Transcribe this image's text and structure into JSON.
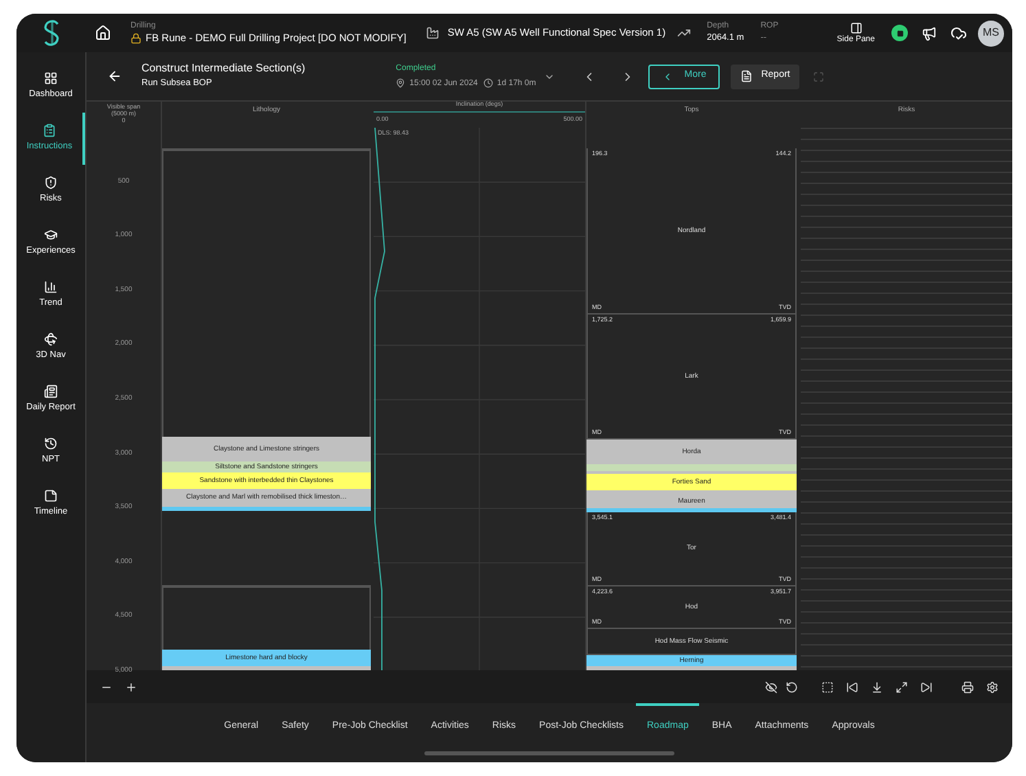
{
  "top_bar": {
    "module_label": "Drilling",
    "project": "FB Rune - DEMO Full Drilling Project [DO NOT MODIFY]",
    "well": "SW A5 (SW A5 Well Functional Spec Version 1)",
    "depth_label": "Depth",
    "depth_value": "2064.1 m",
    "rop_label": "ROP",
    "rop_value": "--",
    "side_pane": "Side Pane",
    "avatar": "MS"
  },
  "sidebar": {
    "items": [
      {
        "label": "Dashboard",
        "selected": false
      },
      {
        "label": "Instructions",
        "selected": true
      },
      {
        "label": "Risks",
        "selected": false
      },
      {
        "label": "Experiences",
        "selected": false
      },
      {
        "label": "Trend",
        "selected": false
      },
      {
        "label": "3D Nav",
        "selected": false
      },
      {
        "label": "Daily Report",
        "selected": false
      },
      {
        "label": "NPT",
        "selected": false
      },
      {
        "label": "Timeline",
        "selected": false
      }
    ]
  },
  "header": {
    "title": "Construct Intermediate Section(s)",
    "subtitle": "Run Subsea BOP",
    "status": "Completed",
    "date": "15:00 02 Jun 2024",
    "duration": "1d 17h 0m",
    "more_button": "More",
    "report_button": "Report"
  },
  "ruler": {
    "title": "Visible span (5000 m)",
    "zero": "0",
    "ticks": [
      "500",
      "1,000",
      "1,500",
      "2,000",
      "2,500",
      "3,000",
      "3,500",
      "4,000",
      "4,500",
      "5,000"
    ]
  },
  "lithology": {
    "title": "Lithology",
    "layers": [
      {
        "text": "Claystone and Limestone stringers",
        "color": "#c0c0c0"
      },
      {
        "text": "Siltstone and Sandstone stringers",
        "color": "#c6ddb4"
      },
      {
        "text": "Sandstone with interbedded thin Claystones",
        "color": "#ffff66"
      },
      {
        "text": "Claystone and Marl with remobilised thick limeston…",
        "color": "#c0c0c0"
      },
      {
        "color": "#5ec8f0"
      },
      {
        "text": "Limestone hard and blocky",
        "color": "#66ccf5"
      },
      {
        "color": "#c0c0c0"
      }
    ]
  },
  "inclination": {
    "title": "Inclination (degs)",
    "min": "0.00",
    "max": "500.00",
    "dls": "DLS: 98.43"
  },
  "tops": {
    "title": "Tops",
    "items": [
      {
        "kind": "box",
        "name": "Nordland",
        "md": "196.3",
        "tvd": "144.2",
        "md_label": "MD",
        "tvd_label": "TVD"
      },
      {
        "kind": "box",
        "name": "Lark",
        "md": "1,725.2",
        "tvd": "1,659.9",
        "md_label": "MD",
        "tvd_label": "TVD"
      },
      {
        "kind": "band",
        "name": "Horda",
        "color": "#c0c0c0"
      },
      {
        "kind": "band",
        "color": "#c6ddb4"
      },
      {
        "kind": "band",
        "color": "#c0c0c0"
      },
      {
        "kind": "band",
        "name": "Forties Sand",
        "color": "#ffff66"
      },
      {
        "kind": "band",
        "color": "#c0c0c0"
      },
      {
        "kind": "band",
        "name": "Maureen",
        "color": "#c0c0c0"
      },
      {
        "kind": "band",
        "color": "#5ec8f0"
      },
      {
        "kind": "box",
        "name": "Tor",
        "md": "3,545.1",
        "tvd": "3,481.4",
        "md_label": "MD",
        "tvd_label": "TVD"
      },
      {
        "kind": "box",
        "name": "Hod",
        "md": "4,223.6",
        "tvd": "3,951.7",
        "md_label": "MD",
        "tvd_label": "TVD"
      },
      {
        "kind": "box",
        "name": "Hod Mass Flow Seismic"
      },
      {
        "kind": "band",
        "name": "Herning",
        "color": "#66ccf5"
      },
      {
        "kind": "band",
        "color": "#c0c0c0"
      }
    ]
  },
  "risks": {
    "title": "Risks"
  },
  "tabs": [
    {
      "label": "General",
      "selected": false
    },
    {
      "label": "Safety",
      "selected": false
    },
    {
      "label": "Pre-Job Checklist",
      "selected": false
    },
    {
      "label": "Activities",
      "selected": false
    },
    {
      "label": "Risks",
      "selected": false
    },
    {
      "label": "Post-Job Checklists",
      "selected": false
    },
    {
      "label": "Roadmap",
      "selected": true
    },
    {
      "label": "BHA",
      "selected": false
    },
    {
      "label": "Attachments",
      "selected": false
    },
    {
      "label": "Approvals",
      "selected": false
    }
  ]
}
